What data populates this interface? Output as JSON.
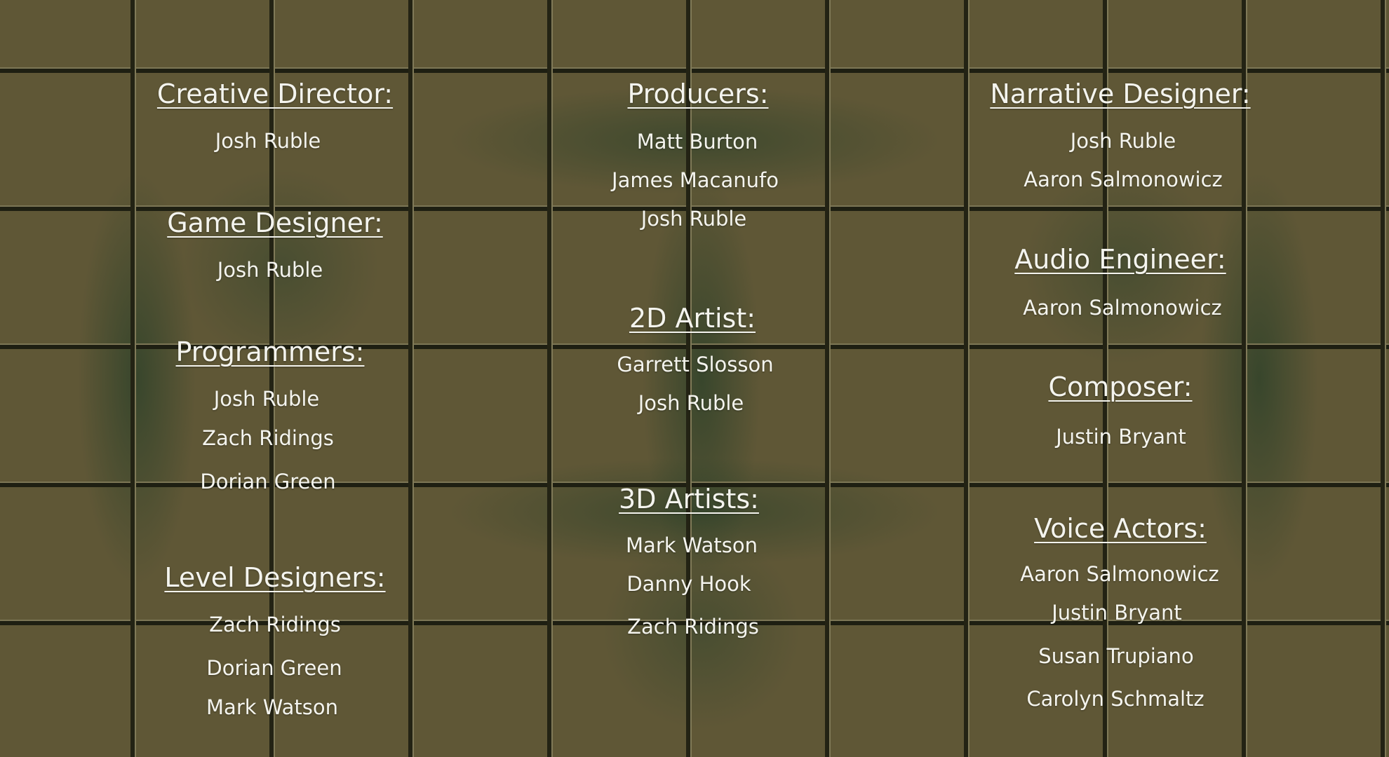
{
  "credits": {
    "creative_director": {
      "title": "Creative Director:",
      "names": [
        "Josh Ruble"
      ]
    },
    "game_designer": {
      "title": "Game Designer:",
      "names": [
        "Josh Ruble"
      ]
    },
    "programmers": {
      "title": "Programmers:",
      "names": [
        "Josh Ruble",
        "Zach Ridings",
        "Dorian Green"
      ]
    },
    "level_designers": {
      "title": "Level Designers:",
      "names": [
        "Zach Ridings",
        "Dorian Green",
        "Mark Watson"
      ]
    },
    "producers": {
      "title": "Producers:",
      "names": [
        "Matt Burton",
        "James Macanufo",
        "Josh Ruble"
      ]
    },
    "artist_2d": {
      "title": "2D Artist:",
      "names": [
        "Garrett Slosson",
        "Josh Ruble"
      ]
    },
    "artists_3d": {
      "title": "3D Artists:",
      "names": [
        "Mark Watson",
        "Danny Hook",
        "Zach Ridings"
      ]
    },
    "narrative_designer": {
      "title": "Narrative Designer:",
      "names": [
        "Josh Ruble",
        "Aaron Salmonowicz"
      ]
    },
    "audio_engineer": {
      "title": "Audio Engineer:",
      "names": [
        "Aaron Salmonowicz"
      ]
    },
    "composer": {
      "title": "Composer:",
      "names": [
        "Justin Bryant"
      ]
    },
    "voice_actors": {
      "title": "Voice Actors:",
      "names": [
        "Aaron Salmonowicz",
        "Justin Bryant",
        "Susan Trupiano",
        "Carolyn Schmaltz"
      ]
    }
  },
  "colors": {
    "text": "#f4f4ee",
    "tile": "#5f5736",
    "grout": "#232314",
    "glow": "#183824"
  }
}
